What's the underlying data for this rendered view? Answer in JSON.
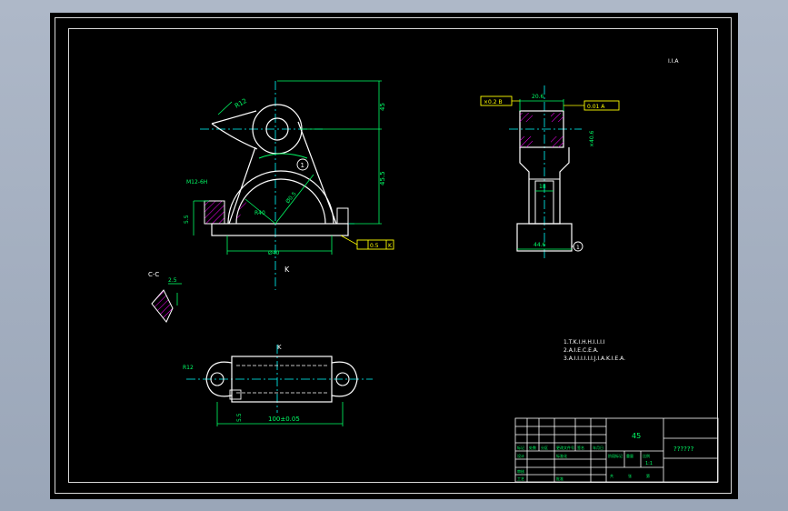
{
  "drawing": {
    "tech_notes": [
      "1.T.K.I.H.H.I.I.I.I",
      "2.A.I.E.C.E.A.",
      "3.A.I.I.I.I.I.I.J.I.A.K.I.E.A."
    ],
    "top_right_mark": "I.I.A",
    "front_view": {
      "hole_radius_label": "R12",
      "height_upper": "45",
      "height_total": "45.5",
      "bore_label": "Ø0.5",
      "bore_radius_label": "R40",
      "bottom_width": "Ø40",
      "left_height": "5.5",
      "left_thread": "M12-6H",
      "flatness_value": "0.5",
      "flatness_ref": "K",
      "circle_marker": "1",
      "arrow_label": "K"
    },
    "side_view": {
      "datum_box": "×0.2 B",
      "parallel_box": "0.01 A",
      "top_dim": "20.6",
      "slot_dim": "18",
      "base_width": "44.6",
      "right_dim": "×40.6",
      "circle_marker": "1"
    },
    "section_cc": {
      "label": "C-C",
      "dim": "2.5"
    },
    "top_view": {
      "center_label": "K",
      "radius_label": "R12",
      "length": "100±0.05",
      "height": "5.5"
    },
    "title_block": {
      "material": "45",
      "name": "??????",
      "scale": "1:1",
      "labels": [
        "标记",
        "处数",
        "分区",
        "更改文件号",
        "签名",
        "年月日",
        "阶段标记",
        "重量",
        "比例",
        "设计",
        "标准化",
        "审核",
        "工艺",
        "批准",
        "共",
        "张",
        "第"
      ]
    }
  },
  "colors": {
    "line": "#ffffff",
    "dim": "#00ff66",
    "center": "#00ffff",
    "hatch": "#ff00ff",
    "tolerance": "#ffff00"
  }
}
